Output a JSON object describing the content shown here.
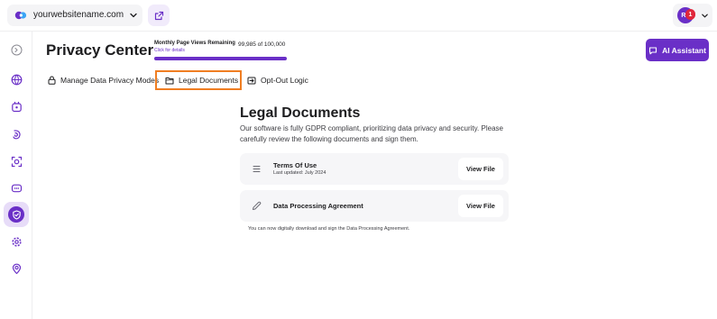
{
  "topbar": {
    "site_name": "yourwebsitename.com",
    "site_icon": "site-logo-icon",
    "external_link_icon": "external-link-icon",
    "avatar_initials": "RF",
    "notification_count": "1"
  },
  "sidebar": {
    "items": [
      {
        "name": "collapse-sidebar-icon",
        "active": false
      },
      {
        "name": "globe-icon",
        "active": false
      },
      {
        "name": "cookie-icon",
        "active": false
      },
      {
        "name": "accessibility-icon",
        "active": false
      },
      {
        "name": "scan-icon",
        "active": false
      },
      {
        "name": "chat-icon",
        "active": false
      },
      {
        "name": "privacy-shield-icon",
        "active": true
      },
      {
        "name": "settings-icon",
        "active": false
      },
      {
        "name": "user-location-icon",
        "active": false
      }
    ]
  },
  "header": {
    "title": "Privacy Center",
    "page_views_label": "Monthly Page Views Remaining",
    "page_views_link": "Click for details",
    "page_views_count": "99,985 of 100,000",
    "page_views_remaining_fraction": 0.99985,
    "ai_button_label": "AI Assistant"
  },
  "tabs": [
    {
      "label": "Manage Data Privacy Modes",
      "icon": "lock-icon"
    },
    {
      "label": "Legal Documents",
      "icon": "folder-icon"
    },
    {
      "label": "Opt-Out Logic",
      "icon": "opt-out-icon"
    }
  ],
  "main": {
    "title": "Legal Documents",
    "description": "Our software is fully GDPR compliant, prioritizing data privacy and security. Please carefully review the following documents and sign them.",
    "documents": [
      {
        "name": "Terms Of Use",
        "updated": "Last updated: July 2024",
        "button": "View File",
        "icon": "list-icon"
      },
      {
        "name": "Data Processing Agreement",
        "updated": "",
        "button": "View File",
        "icon": "pen-icon"
      }
    ],
    "note": "You can now digitally download and sign the Data Processing Agreement."
  },
  "colors": {
    "accent": "#6a2fc7",
    "highlight": "#f07e22",
    "badge": "#e0273a"
  }
}
